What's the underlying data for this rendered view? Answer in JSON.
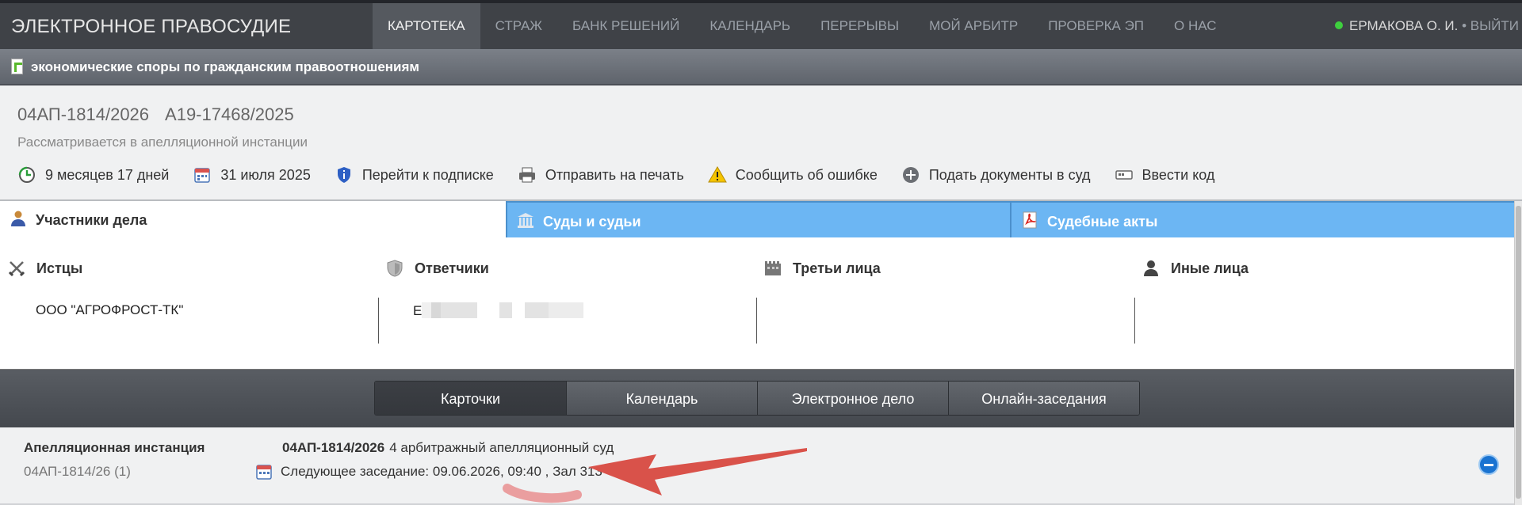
{
  "topbar": {
    "logo": "ЭЛЕКТРОННОЕ ПРАВОСУДИЕ",
    "nav": [
      {
        "label": "КАРТОТЕКА",
        "active": true
      },
      {
        "label": "СТРАЖ"
      },
      {
        "label": "БАНК РЕШЕНИЙ"
      },
      {
        "label": "КАЛЕНДАРЬ"
      },
      {
        "label": "ПЕРЕРЫВЫ"
      },
      {
        "label": "МОЙ АРБИТР"
      },
      {
        "label": "ПРОВЕРКА ЭП"
      },
      {
        "label": "О НАС"
      }
    ],
    "user_name": "ЕРМАКОВА О. И.",
    "logout_label": "• ВЫЙТИ"
  },
  "category": {
    "label": "экономические споры по гражданским правоотношениям"
  },
  "case": {
    "number_appeal": "04АП-1814/2026",
    "number_first": "А19-17468/2025",
    "status": "Рассматривается в апелляционной инстанции",
    "actions": [
      {
        "label": "9 месяцев 17 дней",
        "icon": "clock-icon"
      },
      {
        "label": "31 июля 2025",
        "icon": "calendar-icon"
      },
      {
        "label": "Перейти к подписке",
        "icon": "subscribe-shield-icon"
      },
      {
        "label": "Отправить на печать",
        "icon": "printer-icon"
      },
      {
        "label": "Сообщить об ошибке",
        "icon": "warning-icon"
      },
      {
        "label": "Подать документы в суд",
        "icon": "plus-circle-icon"
      },
      {
        "label": "Ввести код",
        "icon": "code-card-icon"
      }
    ]
  },
  "tabs": [
    {
      "label": "Участники дела",
      "icon": "person-icon",
      "active": true
    },
    {
      "label": "Суды и судьи",
      "icon": "courthouse-icon"
    },
    {
      "label": "Судебные акты",
      "icon": "pdf-icon"
    }
  ],
  "participants": {
    "plaintiffs": {
      "heading": "Истцы",
      "value": "ООО \"АГРОФРОСТ-ТК\""
    },
    "defendants": {
      "heading": "Ответчики",
      "value": "Е"
    },
    "third_parties": {
      "heading": "Третьи лица",
      "value": ""
    },
    "others": {
      "heading": "Иные лица",
      "value": ""
    }
  },
  "subtabs": [
    {
      "label": "Карточки",
      "active": true
    },
    {
      "label": "Календарь"
    },
    {
      "label": "Электронное дело"
    },
    {
      "label": "Онлайн-заседания"
    }
  ],
  "instance": {
    "title": "Апелляционная инстанция",
    "short_number": "04АП-1814/26 (1)",
    "case_number": "04АП-1814/2026",
    "court": "4 арбитражный апелляционный суд",
    "next_hearing": "Следующее заседание: 09.06.2026, 09:40 , Зал 313"
  },
  "colors": {
    "topbar": "#3f4247",
    "tab_blue": "#6cb6f3",
    "annotation_arrow": "#d9524a"
  }
}
